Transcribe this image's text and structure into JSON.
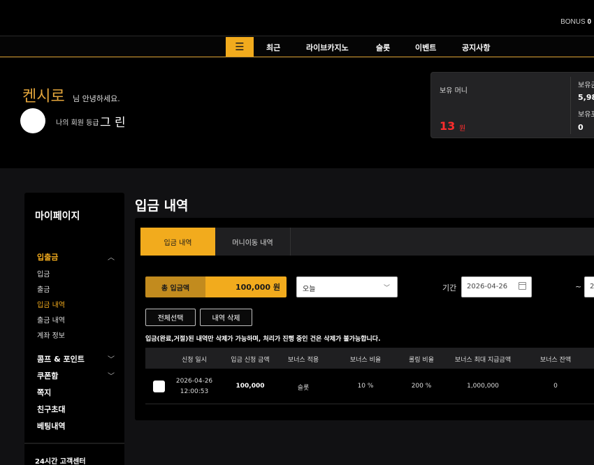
{
  "topbar": {
    "bonus_label": "BONUS",
    "bonus_value": "0"
  },
  "nav": {
    "menu_icon": "hamburger-icon",
    "items": [
      "최근",
      "라이브카지노",
      "슬롯",
      "이벤트",
      "공지사항"
    ]
  },
  "profile": {
    "username": "켄시로",
    "greeting": "님 안녕하세요.",
    "grade_label": "나의 회원 등급",
    "grade_value": "그 린"
  },
  "money": {
    "label": "보유 머니",
    "amount": "13",
    "unit": "원",
    "side_label_1": "보유금",
    "side_value_1": "5,98",
    "side_label_2": "보유포",
    "side_value_2": "0"
  },
  "sidebar": {
    "title": "마이페이지",
    "deposit_group": "입출금",
    "deposit_items": [
      "입금",
      "출금",
      "입금 내역",
      "출금 내역",
      "계좌 정보"
    ],
    "comp_point": "콤프 & 포인트",
    "coupon": "쿠폰함",
    "message": "쪽지",
    "invite": "친구초대",
    "betting": "베팅내역",
    "support": "24시간 고객센터"
  },
  "main": {
    "title": "입금 내역",
    "tabs": [
      "입금 내역",
      "머니이동 내역"
    ],
    "total_label": "총 입금액",
    "total_value": "100,000 원",
    "period_select": "오늘",
    "period_label": "기간",
    "date_from": "2026-04-26",
    "tilde": "~",
    "date_to_partial": "2",
    "select_all_button": "전체선택",
    "delete_button": "내역 삭제",
    "notice": "입금(완료,거절)된 내역만 삭제가 가능하며, 처리가 진행 중인 건은 삭제가 불가능합니다.",
    "columns": [
      "신청 일시",
      "입금 신청 금액",
      "보너스 적용",
      "보너스 비율",
      "롤링 비율",
      "보너스 최대 지급금액",
      "보너스 잔액"
    ],
    "rows": [
      {
        "date": "2026-04-26",
        "time": "12:00:53",
        "amount": "100,000",
        "bonus_applied": "슬롯",
        "bonus_rate": "10 %",
        "rolling_rate": "200 %",
        "bonus_max": "1,000,000",
        "bonus_balance": "0"
      }
    ]
  },
  "colors": {
    "accent": "#f2ab1d",
    "accent_dark": "#c28b1e",
    "money_red": "#ff2d2d",
    "username": "#e3a53b"
  }
}
